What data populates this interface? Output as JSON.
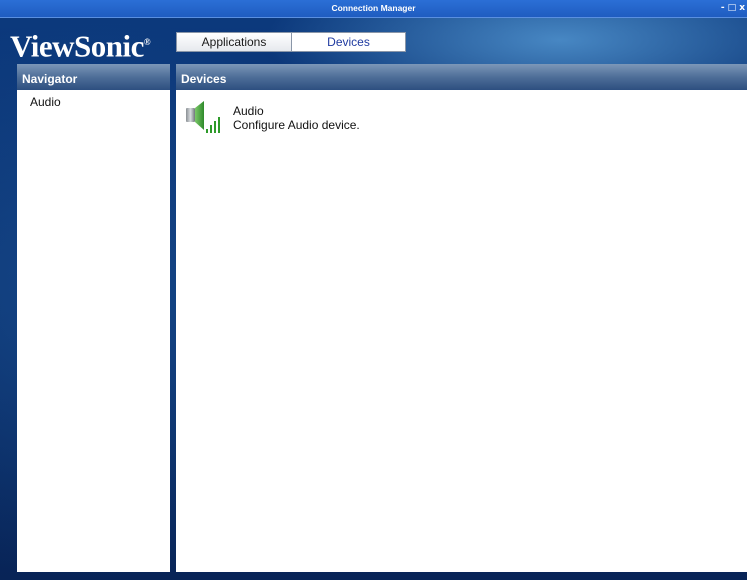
{
  "window": {
    "title": "Connection Manager",
    "controls": {
      "minimize": "-",
      "maximize": "□",
      "close": "x"
    }
  },
  "brand": {
    "logo_text": "ViewSonic",
    "logo_mark": "®",
    "color": "#ffffff"
  },
  "tabs": [
    {
      "label": "Applications",
      "active": false
    },
    {
      "label": "Devices",
      "active": true
    }
  ],
  "navigator": {
    "header": "Navigator",
    "items": [
      {
        "label": "Audio"
      }
    ]
  },
  "main": {
    "header": "Devices",
    "devices": [
      {
        "name": "Audio",
        "description": "Configure Audio device.",
        "icon": "speaker-icon"
      }
    ]
  },
  "colors": {
    "background": "#0b2f6b",
    "titlebar": "#1f5cc0",
    "header": "#4e6e98",
    "panel": "#ffffff",
    "icon_green": "#2e9a2a"
  }
}
